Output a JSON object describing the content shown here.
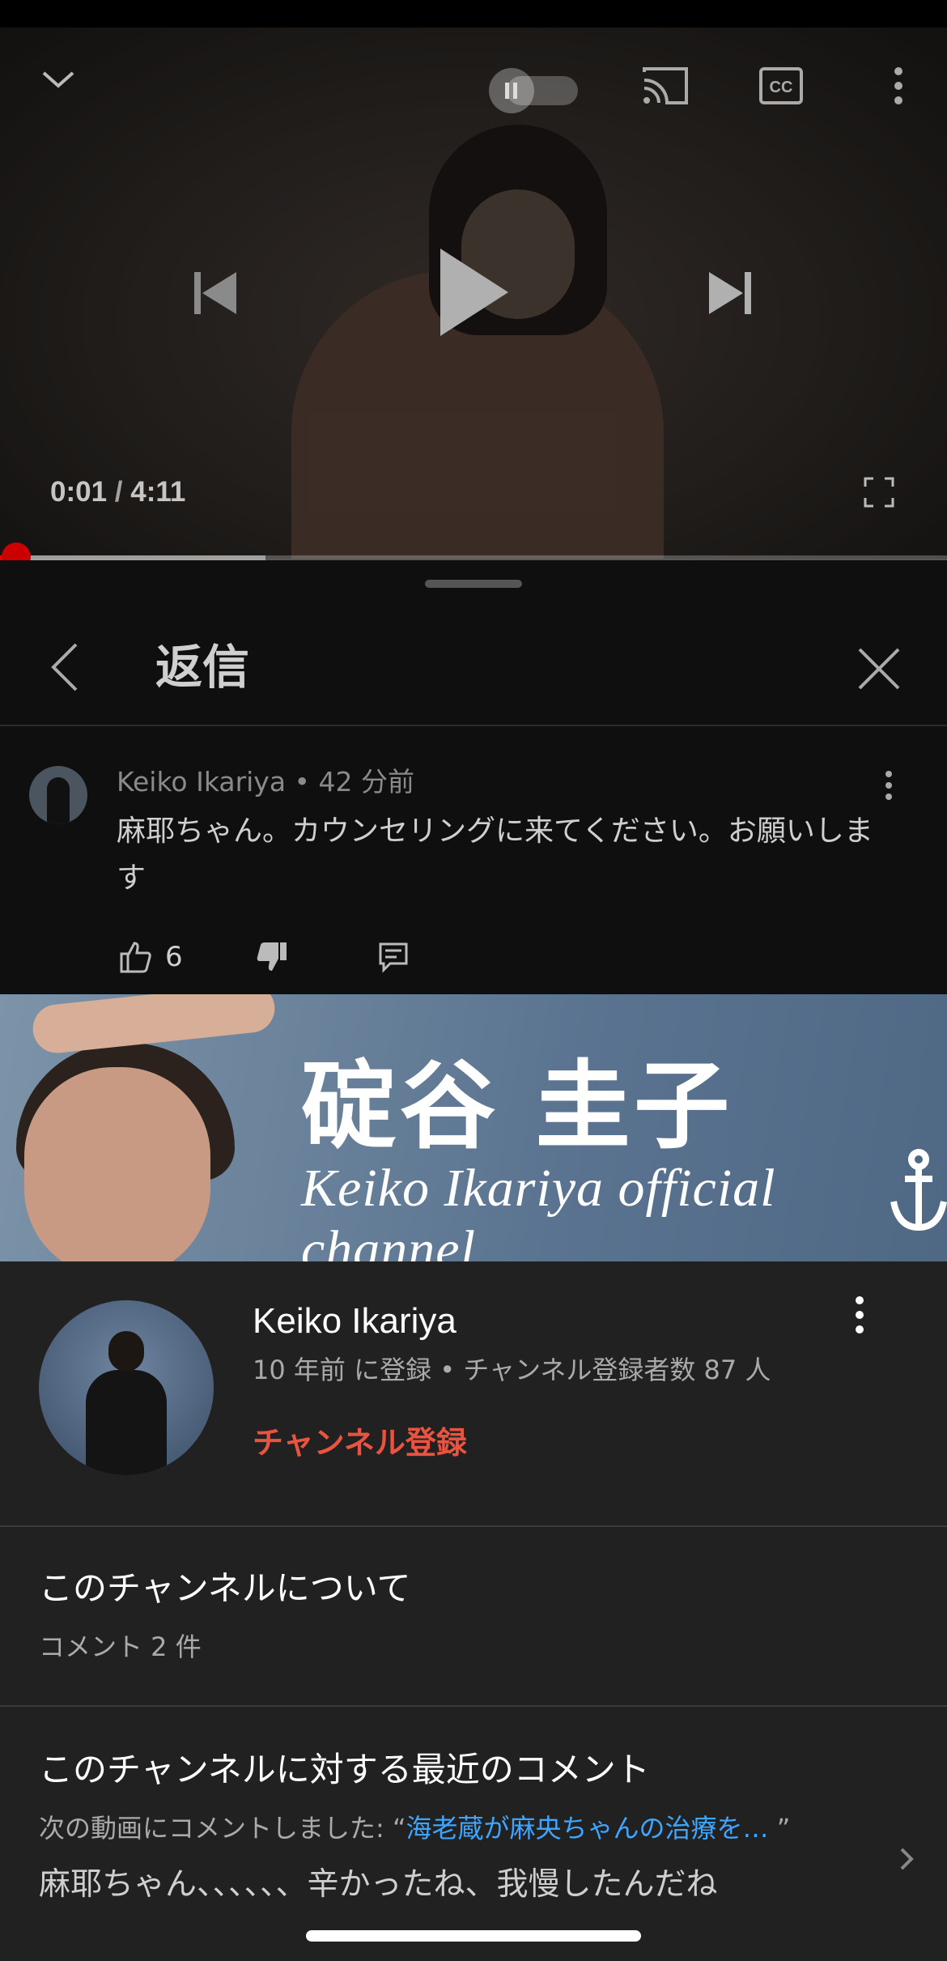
{
  "player": {
    "current_time": "0:01",
    "separator": " / ",
    "duration": "4:11",
    "progress_played_fraction": 0.02,
    "progress_buffered_fraction": 0.28,
    "icons": [
      "chevron-down-icon",
      "pause-icon",
      "cast-icon",
      "cc-icon",
      "more-vertical-icon",
      "previous-icon",
      "play-icon",
      "next-icon",
      "fullscreen-icon"
    ]
  },
  "panel": {
    "title": "返信"
  },
  "comment": {
    "author": "Keiko Ikariya",
    "dot": " • ",
    "time": "42 分前",
    "text": "麻耶ちゃん。カウンセリングに来てください。お願いします",
    "like_count": "6"
  },
  "banner": {
    "name_jp": "碇谷 圭子",
    "name_en": "Keiko Ikariya official channel"
  },
  "channel": {
    "name": "Keiko Ikariya",
    "stats": "10 年前 に登録 • チャンネル登録者数 87 人",
    "subscribe_label": "チャンネル登録",
    "subscribe_color": "#e8543f"
  },
  "about": {
    "title": "このチャンネルについて",
    "subtitle": "コメント 2 件"
  },
  "recent": {
    "title": "このチャンネルに対する最近のコメント",
    "prefix": "次の動画にコメントしました: “",
    "video_link": "海老蔵が麻央ちゃんの治療を…",
    "suffix": "  ”",
    "comment": "麻耶ちゃん、、、、、、辛かったね、我慢したんだね",
    "link_color": "#3ea6ff"
  }
}
